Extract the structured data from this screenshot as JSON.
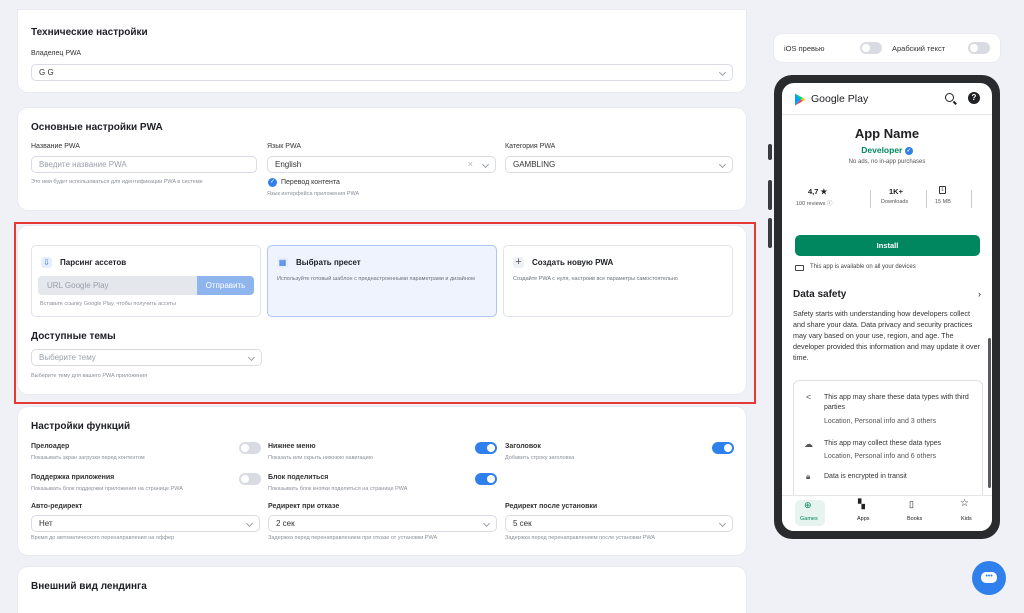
{
  "tech": {
    "title": "Технические настройки",
    "owner_label": "Владелец PWA",
    "owner_value": "G G"
  },
  "basic": {
    "title": "Основные настройки PWA",
    "name_label": "Название PWA",
    "name_placeholder": "Введите название PWA",
    "name_hint": "Это имя будет использоваться для идентификации PWA в системе",
    "lang_label": "Язык PWA",
    "lang_value": "English",
    "translate_label": "Перевод контента",
    "translate_hint": "Язык интерфейса приложения PWA",
    "cat_label": "Категория PWA",
    "cat_value": "GAMBLING"
  },
  "options": {
    "parse": {
      "title": "Парсинг ассетов",
      "input_placeholder": "URL Google Play",
      "send": "Отправить",
      "hint": "Вставьте ссылку Google Play, чтобы получить ассеты"
    },
    "preset": {
      "title": "Выбрать пресет",
      "desc": "Используйте готовый шаблон с преднастроенными параметрами и дизайном"
    },
    "create": {
      "title": "Создать новую PWA",
      "desc": "Создайте PWA с нуля, настроив все параметры самостоятельно"
    },
    "themes_title": "Доступные темы",
    "theme_placeholder": "Выберите тему",
    "theme_hint": "Выберите тему для вашего PWA приложения"
  },
  "functions": {
    "title": "Настройки функций",
    "preloader": {
      "label": "Прелоадер",
      "hint": "Показывать экран загрузки перед контентом"
    },
    "bottom_menu": {
      "label": "Нижнее меню",
      "hint": "Показать или скрыть нижнюю навигацию"
    },
    "header": {
      "label": "Заголовок",
      "hint": "Добавить строку заголовка"
    },
    "support": {
      "label": "Поддержка приложения",
      "hint": "Показывать блок поддержки приложения на странице PWA"
    },
    "share": {
      "label": "Блок поделиться",
      "hint": "Показывать блок кнопки поделиться на странице PWA"
    },
    "auto_redirect": {
      "label": "Авто-редирект",
      "value": "Нет",
      "hint": "Время до автоматического перенаправления на оффер"
    },
    "fail_redirect": {
      "label": "Редирект при отказе",
      "value": "2 сек",
      "hint": "Задержка перед перенаправлением при отказе от установки PWA"
    },
    "install_redirect": {
      "label": "Редирект после установки",
      "value": "5 сек",
      "hint": "Задержка перед перенаправлением после установки PWA"
    }
  },
  "landing": {
    "title": "Внешний вид лендинга"
  },
  "preview": {
    "ios_label": "iOS превью",
    "arabic_label": "Арабский текст"
  },
  "phone": {
    "store": "Google Play",
    "app_name": "App Name",
    "developer": "Developer",
    "ads": "No ads, no in-app purchases",
    "rating": "4,7 ★",
    "reviews": "100 reviews ⓘ",
    "downloads_val": "1K+",
    "downloads": "Downloads",
    "size": "15 MB",
    "install": "Install",
    "devices": "This app is available on all your devices",
    "safety_title": "Data safety",
    "safety_text": "Safety starts with understanding how developers collect and share your data. Data privacy and security practices may vary based on your use, region, and age. The developer provided this information and may update it over time.",
    "share_title": "This app may share these data types with third parties",
    "share_sub": "Location, Personal info and 3 others",
    "collect_title": "This app may collect these data types",
    "collect_sub": "Location, Personal info and 6 others",
    "encrypt": "Data is encrypted in transit",
    "nav": [
      "Games",
      "Apps",
      "Books",
      "Kids"
    ]
  },
  "colors": {
    "accent": "#2f80ed",
    "play_green": "#01875f",
    "highlight": "#e53935"
  }
}
